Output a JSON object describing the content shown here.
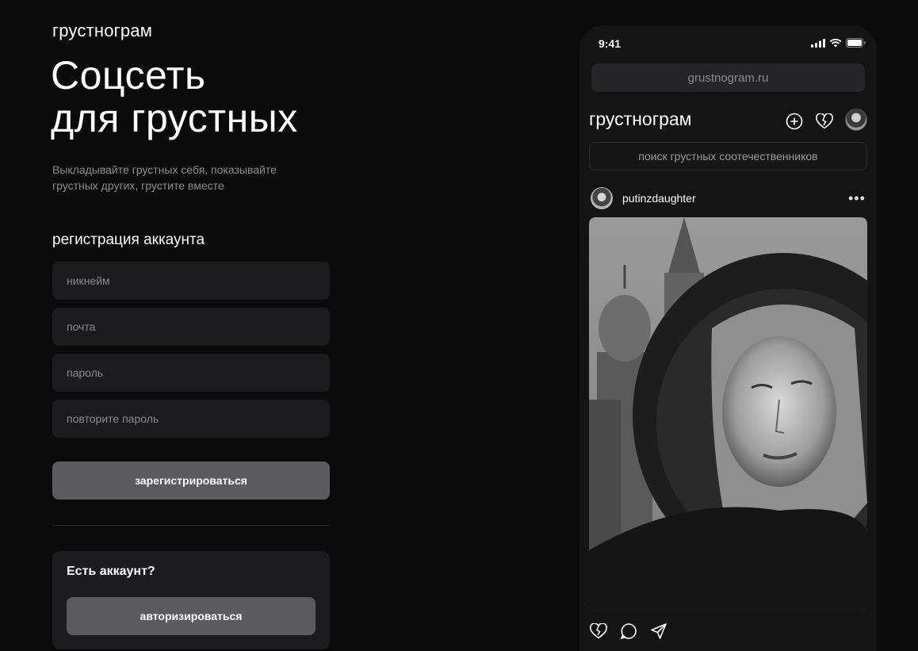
{
  "brand": "грустнограм",
  "hero": {
    "title_line1": "Соцсеть",
    "title_line2": "для грустных",
    "subtitle": "Выкладывайте грустных себя, показывайте грустных других, грустите вместе"
  },
  "registration": {
    "title": "регистрация аккаунта",
    "nickname_placeholder": "никнейм",
    "email_placeholder": "почта",
    "password_placeholder": "пароль",
    "repeat_password_placeholder": "повторите пароль",
    "submit_label": "зарегистрироваться"
  },
  "login": {
    "title": "Есть аккаунт?",
    "button_label": "авторизироваться"
  },
  "phone": {
    "time": "9:41",
    "url": "grustnogram.ru",
    "app_title": "грустнограм",
    "search_placeholder": "поиск грустных соотечественников",
    "post": {
      "username": "putinzdaughter",
      "more": "•••"
    }
  },
  "icons": {
    "add": "plus-circle-icon",
    "likes": "broken-heart-icon",
    "comment": "comment-bubble-icon",
    "share": "send-icon"
  }
}
